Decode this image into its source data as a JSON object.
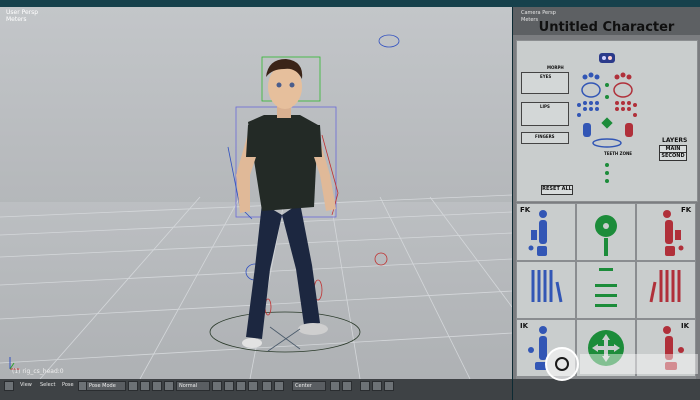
{
  "viewport": {
    "view_name": "User Persp",
    "view_units": "Meters",
    "object_label": "(1) rig_cs_head:0"
  },
  "side_panel": {
    "view_name": "Camera Persp",
    "view_units": "Meters",
    "title": "Untitled Character",
    "labels": {
      "morph": "MORPH",
      "eyes": "EYES",
      "lips": "LIPS",
      "fingers": "FINGERS",
      "teeth": "TEETH ZONE",
      "reset_all": "RESET ALL",
      "layers": "LAYERS",
      "main": "MAIN",
      "second": "SECOND",
      "fk": "FK",
      "ik": "IK"
    },
    "colors": {
      "left": "#3256b5",
      "right": "#b0303a",
      "center": "#1c8c3a",
      "panel": "#c9cdcd"
    }
  },
  "toolbar": {
    "view": "View",
    "select": "Select",
    "pose": "Pose",
    "mode": "Pose Mode",
    "shading": "Normal",
    "pivot": "Center"
  }
}
